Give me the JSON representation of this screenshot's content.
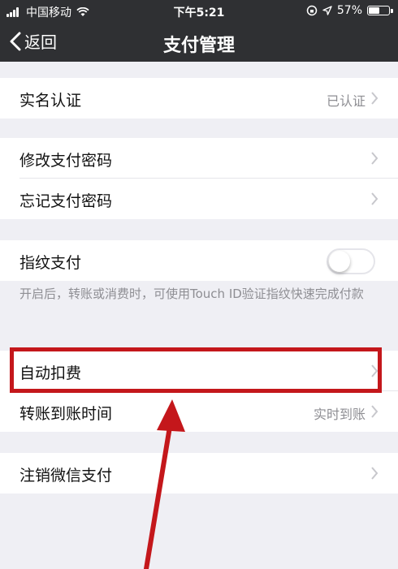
{
  "status": {
    "carrier": "中国移动",
    "time": "下午5:21",
    "battery_pct": "57%",
    "battery_level": 0.57
  },
  "nav": {
    "back_label": "返回",
    "title": "支付管理"
  },
  "rows": {
    "realname": {
      "label": "实名认证",
      "value": "已认证"
    },
    "change_password": {
      "label": "修改支付密码"
    },
    "forgot_password": {
      "label": "忘记支付密码"
    },
    "fingerprint": {
      "label": "指纹支付",
      "enabled": false
    },
    "fingerprint_hint": "开启后，转账或消费时，可使用Touch ID验证指纹快速完成付款",
    "auto_deduct": {
      "label": "自动扣费"
    },
    "transfer_time": {
      "label": "转账到账时间",
      "value": "实时到账"
    },
    "cancel_wechat_pay": {
      "label": "注销微信支付"
    }
  },
  "annotation": {
    "color": "#c4171b"
  },
  "colors": {
    "navbar": "#2f3033",
    "background": "#efeff4",
    "secondary_text": "#8e8e93"
  },
  "icons": [
    "signal-icon",
    "wifi-icon",
    "lock-rotation-icon",
    "location-icon",
    "battery-icon",
    "back-chevron-icon",
    "chevron-right-icon"
  ]
}
